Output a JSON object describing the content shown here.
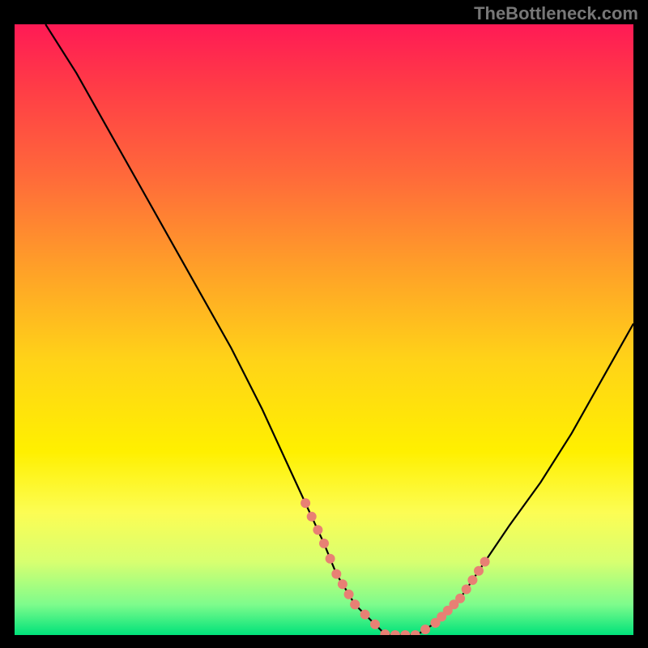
{
  "attribution": "TheBottleneck.com",
  "chart_data": {
    "type": "line",
    "title": "",
    "xlabel": "",
    "ylabel": "",
    "xlim": [
      0,
      100
    ],
    "ylim": [
      0,
      100
    ],
    "series": [
      {
        "name": "bottleneck-curve",
        "x": [
          5,
          10,
          15,
          20,
          25,
          30,
          35,
          40,
          45,
          50,
          52,
          55,
          58,
          60,
          62,
          65,
          68,
          72,
          76,
          80,
          85,
          90,
          95,
          100
        ],
        "y": [
          100,
          92,
          83,
          74,
          65,
          56,
          47,
          37,
          26,
          15,
          10,
          5,
          2,
          0,
          0,
          0,
          2,
          6,
          12,
          18,
          25,
          33,
          42,
          51
        ]
      }
    ],
    "highlight_segments": [
      {
        "name": "left-marker-band",
        "x_range": [
          47,
          55
        ],
        "style": "coral-dots"
      },
      {
        "name": "right-marker-band",
        "x_range": [
          68,
          76
        ],
        "style": "coral-dots"
      },
      {
        "name": "trough-marker-band",
        "x_range": [
          55,
          68
        ],
        "style": "coral-dots"
      }
    ],
    "gradient_stops": [
      {
        "pos": 0.0,
        "color": "#ff1a55"
      },
      {
        "pos": 0.25,
        "color": "#ff6a3a"
      },
      {
        "pos": 0.55,
        "color": "#ffd318"
      },
      {
        "pos": 0.8,
        "color": "#fcfd54"
      },
      {
        "pos": 1.0,
        "color": "#00e27a"
      }
    ]
  }
}
